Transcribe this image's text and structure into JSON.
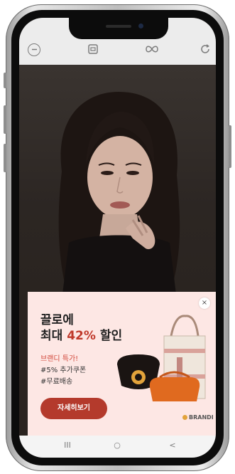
{
  "topbar": {
    "icons": [
      "minus-circle-icon",
      "square-icon",
      "infinity-icon",
      "refresh-icon"
    ]
  },
  "photo": {
    "alt": "model-portrait"
  },
  "ad": {
    "headline_line1": "끌로에",
    "headline_line2_pre": "최대 ",
    "headline_line2_highlight": "42%",
    "headline_line2_post": " 할인",
    "sub1": "브랜디 특가!",
    "sub2": "#5% 추가쿠폰",
    "sub3": "#무료배송",
    "cta_label": "자세히보기",
    "brand": "BRANDI",
    "close_label": "×",
    "accent_color": "#b43a2c",
    "background_color": "#fde7e4"
  },
  "navbar": {
    "recent_label": "III",
    "home_label": "○",
    "back_label": "<"
  }
}
